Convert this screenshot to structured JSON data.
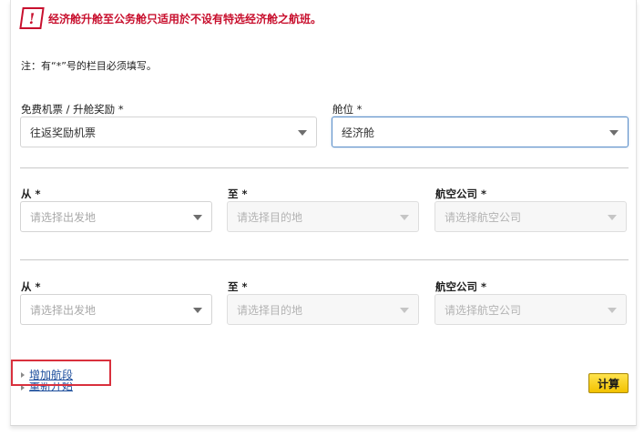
{
  "warning": {
    "icon": "exclamation-icon",
    "icon_glyph": "!",
    "text": "经济舱升舱至公务舱只适用於不设有特选经济舱之航班。",
    "color": "#c8102e"
  },
  "note": "注：有“*”号的栏目必须填写。",
  "award": {
    "label": "免费机票 / 升舱奖励 *",
    "value": "往返奖励机票"
  },
  "cabin": {
    "label": "舱位 *",
    "value": "经济舱"
  },
  "segments": [
    {
      "from_label": "从 *",
      "from_placeholder": "请选择出发地",
      "to_label": "至 *",
      "to_placeholder": "请选择目的地",
      "airline_label": "航空公司 *",
      "airline_placeholder": "请选择航空公司"
    },
    {
      "from_label": "从 *",
      "from_placeholder": "请选择出发地",
      "to_label": "至 *",
      "to_placeholder": "请选择目的地",
      "airline_label": "航空公司 *",
      "airline_placeholder": "请选择航空公司"
    }
  ],
  "links": {
    "add_segment": "增加航段",
    "restart": "重新开始"
  },
  "calculate_button": "计算",
  "colors": {
    "accent_link": "#1d4e9c",
    "button_yellow": "#f9d71c",
    "highlight_red": "#d9303d"
  }
}
